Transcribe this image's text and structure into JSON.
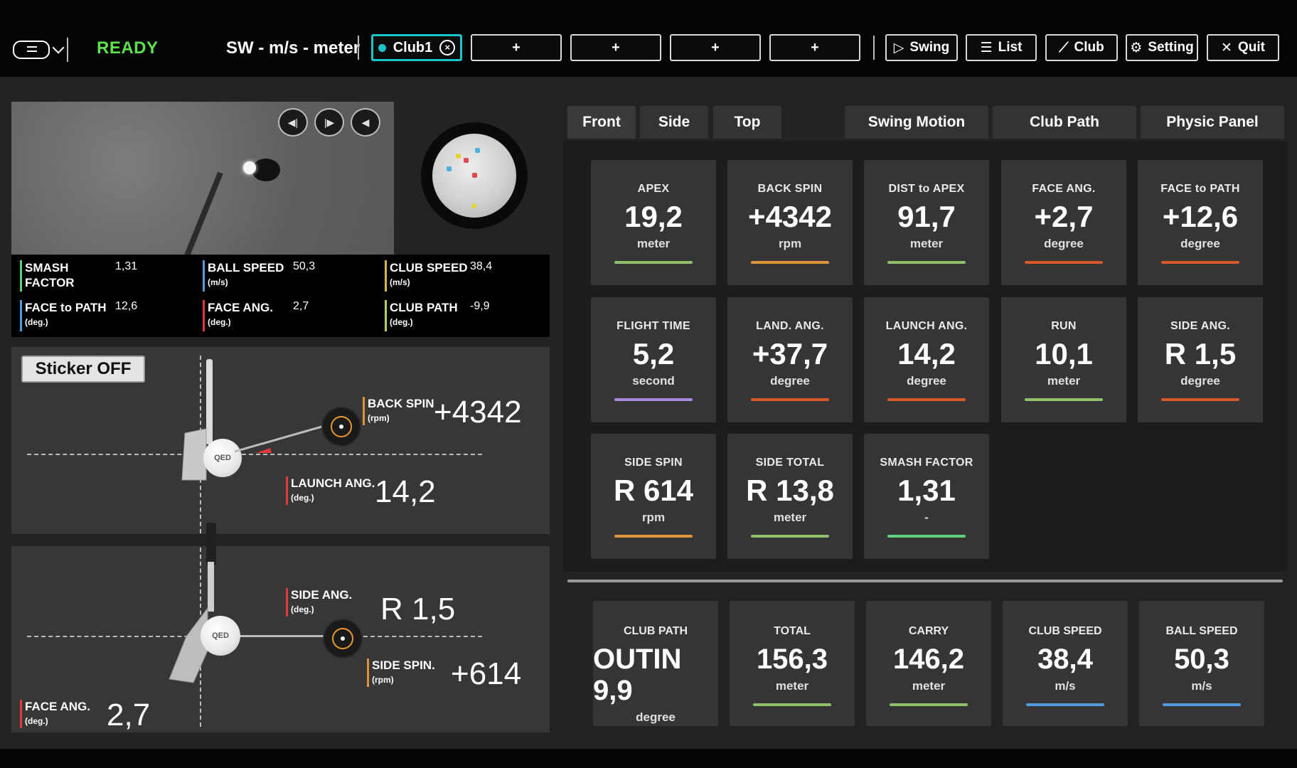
{
  "header": {
    "status": "READY",
    "units": "SW - m/s - meter",
    "club_tab": "Club1",
    "add_tabs": [
      "+",
      "+",
      "+",
      "+"
    ],
    "nav": [
      {
        "label": "Swing",
        "icon": "play-circle-icon"
      },
      {
        "label": "List",
        "icon": "list-icon"
      },
      {
        "label": "Club",
        "icon": "club-icon"
      },
      {
        "label": "Setting",
        "icon": "gear-icon"
      },
      {
        "label": "Quit",
        "icon": "close-icon"
      }
    ]
  },
  "summary": {
    "smash_factor": {
      "label": "SMASH FACTOR",
      "value": "1,31",
      "color": "#5fd17a"
    },
    "ball_speed": {
      "label": "BALL SPEED",
      "unit": "(m/s)",
      "value": "50,3",
      "color": "#4f9be0"
    },
    "club_speed": {
      "label": "CLUB SPEED",
      "unit": "(m/s)",
      "value": "38,4",
      "color": "#d9b84a"
    },
    "face_to_path": {
      "label": "FACE to PATH",
      "unit": "(deg.)",
      "value": "12,6",
      "color": "#4f9be0"
    },
    "face_ang": {
      "label": "FACE ANG.",
      "unit": "(deg.)",
      "value": "2,7",
      "color": "#e03a3a"
    },
    "club_path": {
      "label": "CLUB PATH",
      "unit": "(deg.)",
      "value": "-9,9",
      "color": "#b6d45a"
    }
  },
  "diagram": {
    "sticker": "Sticker OFF",
    "back_spin": {
      "label": "BACK SPIN",
      "unit": "(rpm)",
      "value": "+4342"
    },
    "launch_ang": {
      "label": "LAUNCH ANG.",
      "unit": "(deg.)",
      "value": "14,2"
    },
    "side_ang": {
      "label": "SIDE ANG.",
      "unit": "(deg.)",
      "value": "R 1,5"
    },
    "side_spin": {
      "label": "SIDE SPIN.",
      "unit": "(rpm)",
      "value": "+614"
    },
    "face_ang": {
      "label": "FACE ANG.",
      "unit": "(deg.)",
      "value": "2,7"
    }
  },
  "view_tabs": [
    "Front",
    "Side",
    "Top"
  ],
  "panel_tabs": [
    "Swing Motion",
    "Club Path",
    "Physic Panel"
  ],
  "cards": [
    {
      "title": "APEX",
      "value": "19,2",
      "unit": "meter",
      "color": "#8fbf6a"
    },
    {
      "title": "BACK SPIN",
      "value": "+4342",
      "unit": "rpm",
      "color": "#e0933a"
    },
    {
      "title": "DIST to APEX",
      "value": "91,7",
      "unit": "meter",
      "color": "#8fbf6a"
    },
    {
      "title": "FACE ANG.",
      "value": "+2,7",
      "unit": "degree",
      "color": "#d9582a"
    },
    {
      "title": "FACE to PATH",
      "value": "+12,6",
      "unit": "degree",
      "color": "#d9582a"
    },
    {
      "title": "FLIGHT TIME",
      "value": "5,2",
      "unit": "second",
      "color": "#a78be0"
    },
    {
      "title": "LAND. ANG.",
      "value": "+37,7",
      "unit": "degree",
      "color": "#d9582a"
    },
    {
      "title": "LAUNCH ANG.",
      "value": "14,2",
      "unit": "degree",
      "color": "#d9582a"
    },
    {
      "title": "RUN",
      "value": "10,1",
      "unit": "meter",
      "color": "#8fbf6a"
    },
    {
      "title": "SIDE ANG.",
      "value": "R 1,5",
      "unit": "degree",
      "color": "#d9582a"
    },
    {
      "title": "SIDE SPIN",
      "value": "R 614",
      "unit": "rpm",
      "color": "#e0933a"
    },
    {
      "title": "SIDE TOTAL",
      "value": "R 13,8",
      "unit": "meter",
      "color": "#8fbf6a"
    },
    {
      "title": "SMASH FACTOR",
      "value": "1,31",
      "unit": "-",
      "color": "#5fd17a"
    }
  ],
  "bottom_cards": [
    {
      "title": "CLUB PATH",
      "value": "OUTIN 9,9",
      "unit": "degree",
      "color": "#d9582a"
    },
    {
      "title": "TOTAL",
      "value": "156,3",
      "unit": "meter",
      "color": "#8fbf6a"
    },
    {
      "title": "CARRY",
      "value": "146,2",
      "unit": "meter",
      "color": "#8fbf6a"
    },
    {
      "title": "CLUB SPEED",
      "value": "38,4",
      "unit": "m/s",
      "color": "#4f9be0"
    },
    {
      "title": "BALL SPEED",
      "value": "50,3",
      "unit": "m/s",
      "color": "#4f9be0"
    }
  ]
}
